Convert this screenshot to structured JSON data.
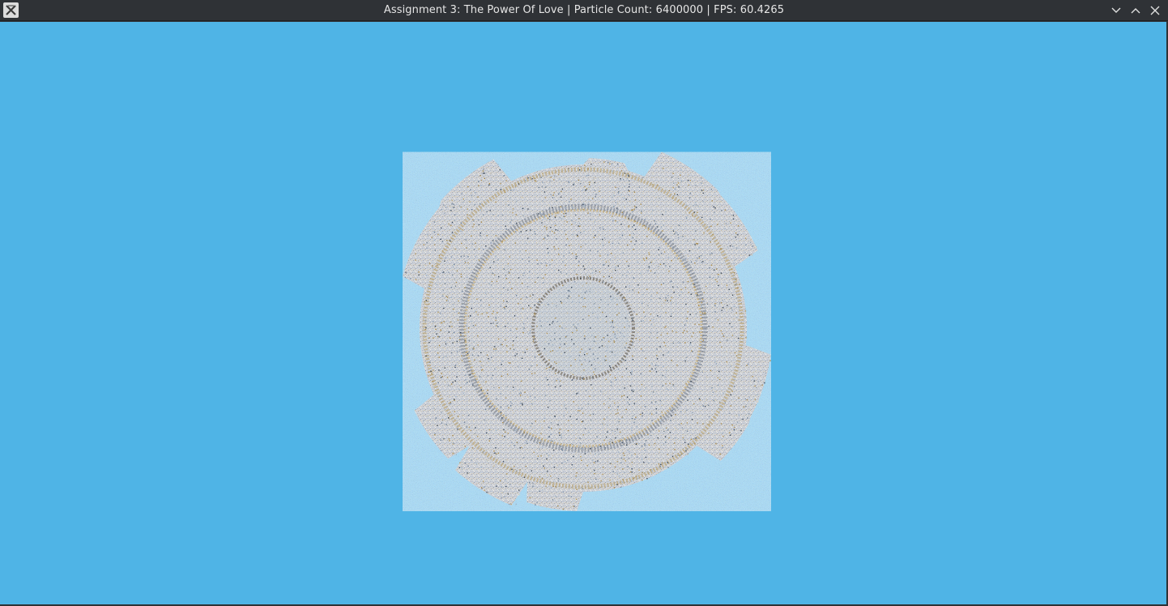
{
  "window": {
    "title": "Assignment 3: The Power Of Love | Particle Count: 6400000 | FPS: 60.4265",
    "app_icon": "x-window-icon",
    "controls": [
      "minimize-icon",
      "maximize-icon",
      "close-icon"
    ]
  },
  "scene": {
    "background_color": "#4fb4e6",
    "object": "particle-gear",
    "particle_palette": [
      "#c9c2b0",
      "#8a9bb0",
      "#b59a62",
      "#6d7f94",
      "#d8d2c0",
      "#3e4b5c",
      "#a88a4c",
      "#9fb2c6"
    ]
  }
}
